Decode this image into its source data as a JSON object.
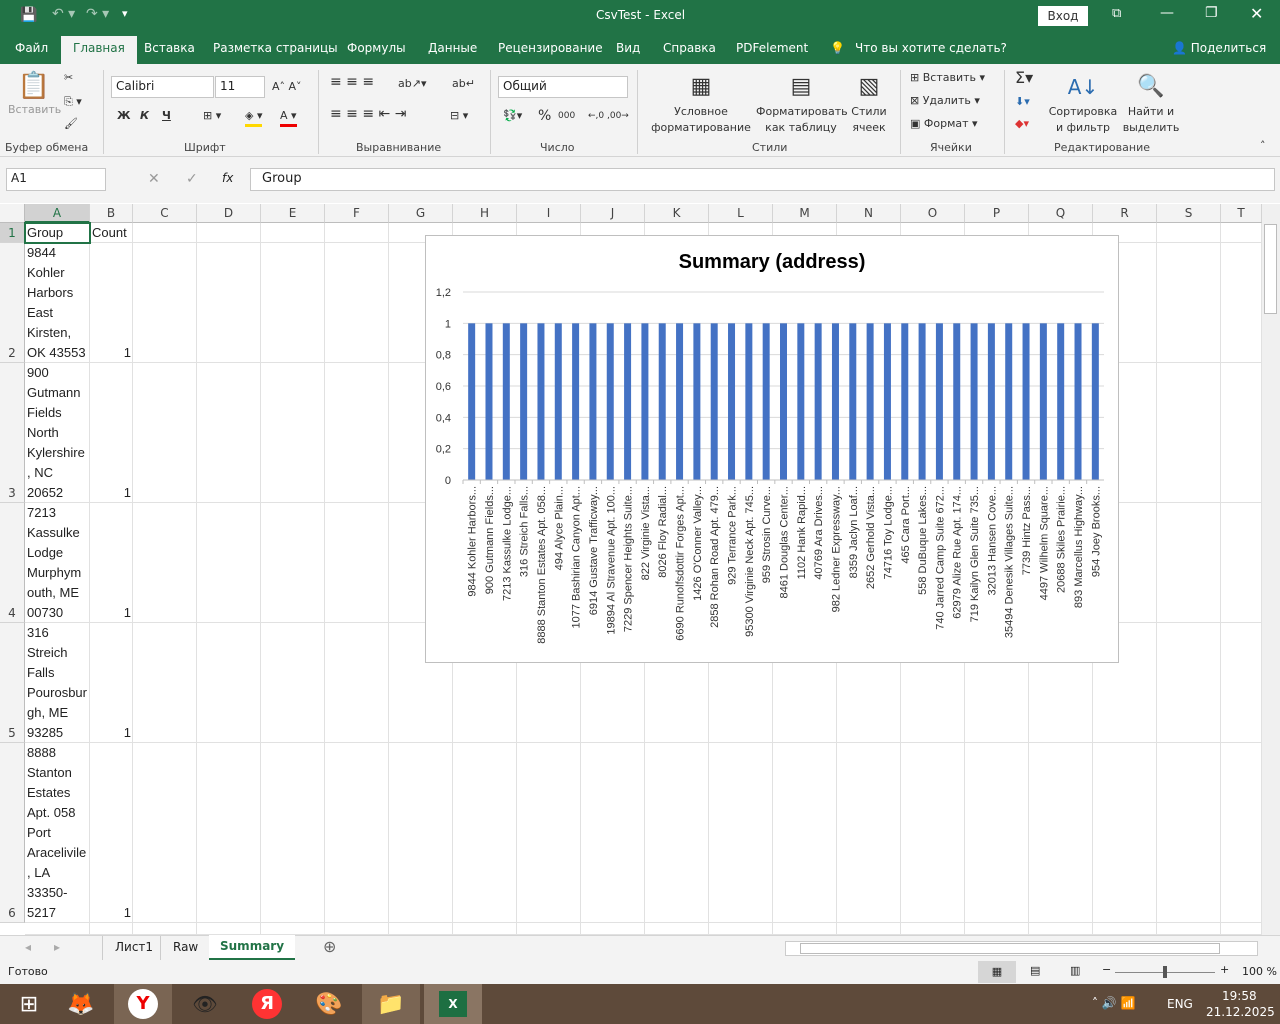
{
  "window": {
    "title": "CsvTest  -  Excel",
    "signin": "Вход"
  },
  "ribbon_tabs": [
    "Файл",
    "Главная",
    "Вставка",
    "Разметка страницы",
    "Формулы",
    "Данные",
    "Рецензирование",
    "Вид",
    "Справка",
    "PDFelement"
  ],
  "tellme": "Что вы хотите сделать?",
  "share": "Поделиться",
  "ribbon": {
    "clipboard": {
      "paste": "Вставить",
      "group": "Буфер обмена"
    },
    "font": {
      "name": "Calibri",
      "size": "11",
      "bold": "Ж",
      "italic": "К",
      "underline": "Ч",
      "group": "Шрифт"
    },
    "alignment": {
      "group": "Выравнивание"
    },
    "number": {
      "format": "Общий",
      "percent": "%",
      "thousands": "000",
      "group": "Число"
    },
    "styles": {
      "cond1": "Условное",
      "cond2": "форматирование",
      "table1": "Форматировать",
      "table2": "как таблицу",
      "cell1": "Стили",
      "cell2": "ячеек",
      "group": "Стили"
    },
    "cells": {
      "insert": "Вставить",
      "delete": "Удалить",
      "format": "Формат",
      "group": "Ячейки"
    },
    "editing": {
      "sort1": "Сортировка",
      "sort2": "и фильтр",
      "find1": "Найти и",
      "find2": "выделить",
      "group": "Редактирование"
    }
  },
  "formula_bar": {
    "name_box": "A1",
    "fx": "fx",
    "value": "Group"
  },
  "columns": [
    "A",
    "B",
    "C",
    "D",
    "E",
    "F",
    "G",
    "H",
    "I",
    "J",
    "K",
    "L",
    "M",
    "N",
    "O",
    "P",
    "Q",
    "R",
    "S",
    "T"
  ],
  "rows": [
    {
      "num": "1",
      "a": "Group",
      "b": "Count"
    },
    {
      "num": "2",
      "a": "9844 Kohler Harbors East Kirsten, OK 43553",
      "b": "1"
    },
    {
      "num": "3",
      "a": "900 Gutmann Fields North Kylershire, NC 20652",
      "b": "1"
    },
    {
      "num": "4",
      "a": "7213 Kassulke Lodge Murphymouth, ME 00730",
      "b": "1"
    },
    {
      "num": "5",
      "a": "316 Streich Falls Pourosburgh, ME 93285",
      "b": "1"
    },
    {
      "num": "6",
      "a": "8888 Stanton Estates Apt. 058 Port Aracelivile, LA 33350-5217",
      "b": "1"
    }
  ],
  "chart_data": {
    "type": "bar",
    "title": "Summary (address)",
    "ylim": [
      0,
      1.2
    ],
    "yticks": [
      "0",
      "0,2",
      "0,4",
      "0,6",
      "0,8",
      "1",
      "1,2"
    ],
    "grid": true,
    "bar_color": "#4472c4",
    "categories": [
      "9844 Kohler Harbors...",
      "900 Gutmann Fields...",
      "7213 Kassulke Lodge...",
      "316 Streich Falls...",
      "8888 Stanton Estates Apt. 058...",
      "494 Alyce Plain...",
      "1077 Bashirian Canyon Apt...",
      "6914 Gustave Trafficway...",
      "19894 Al Stravenue Apt. 100...",
      "7229 Spencer Heights Suite...",
      "822 Virginie Vista...",
      "8026 Floy Radial...",
      "6690 Runolfsdottir Forges Apt...",
      "1426 O'Conner Valley...",
      "2858 Rohan Road Apt. 479...",
      "929 Terrance Park...",
      "95300 Virginie Neck Apt. 745...",
      "959 Strosin Curve...",
      "8461 Douglas Center...",
      "1102 Hank Rapid...",
      "40769 Ara Drives...",
      "982 Ledner Expressway...",
      "8359 Jaclyn Loaf...",
      "2652 Gerhold Vista...",
      "74716 Toy Lodge...",
      "465 Cara Port...",
      "558 DuBuque Lakes...",
      "740 Jarred Camp Suite 672...",
      "62979 Alize Rue Apt. 174...",
      "719 Kailyn Glen Suite 735...",
      "32013 Hansen Cove...",
      "35494 Denesik Villages Suite...",
      "7739 Hintz Pass...",
      "4497 Wilhelm Square...",
      "20688 Skiles Prairie...",
      "893 Marcellus Highway...",
      "954 Joey Brooks..."
    ],
    "values": [
      1,
      1,
      1,
      1,
      1,
      1,
      1,
      1,
      1,
      1,
      1,
      1,
      1,
      1,
      1,
      1,
      1,
      1,
      1,
      1,
      1,
      1,
      1,
      1,
      1,
      1,
      1,
      1,
      1,
      1,
      1,
      1,
      1,
      1,
      1,
      1,
      1
    ]
  },
  "sheets": [
    {
      "name": "Лист1"
    },
    {
      "name": "Raw"
    },
    {
      "name": "Summary",
      "active": true
    }
  ],
  "status": {
    "ready": "Готово",
    "zoom": "100 %"
  },
  "taskbar": {
    "lang": "ENG",
    "time": "19:58",
    "date": "21.12.2025"
  }
}
